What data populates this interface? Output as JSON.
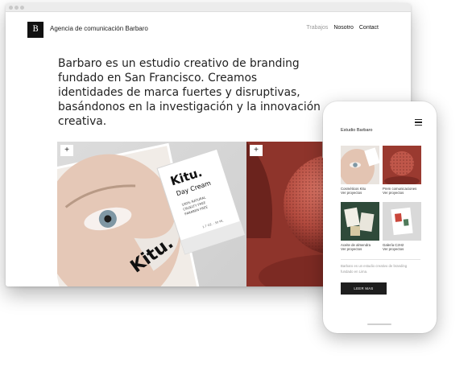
{
  "desktop": {
    "logo_letter": "B",
    "brand": "Agencia de comunicación Barbaro",
    "nav": [
      "Trabajos",
      "Nosotro",
      "Contact"
    ],
    "hero": "Barbaro es un estudio creativo de branding fundado en San Francisco. Creamos identidades de marca fuertes y disruptivas, basándonos en la investigación y la innovación creativa.",
    "plus": "+",
    "product": {
      "brand": "Kitu.",
      "name": "Day Cream",
      "details": [
        "100% NATURAL",
        "CRUELTY FREE",
        "PARABEN FREE"
      ],
      "size": "1.7 OZ. - 50 ML",
      "face_logo": "Kitu."
    }
  },
  "phone": {
    "title": "Estudio Barbaro",
    "items": [
      {
        "name": "Cosméticos Kitu",
        "link": "Ver proyectos"
      },
      {
        "name": "Prem comunicaciones",
        "link": "Ver proyectos"
      },
      {
        "name": "Aceite de almendra",
        "link": "Ver proyectos"
      },
      {
        "name": "Galería C2H2",
        "link": "Ver proyectos"
      }
    ],
    "blurb": "Barbaro es un estudio creativo de branding fundado en Lima.",
    "button": "LEER MAS"
  },
  "colors": {
    "nav_muted": "#9a9a9a",
    "image_red": "#a8433a",
    "thumb_green": "#2f4a3a",
    "button_dark": "#1e1e1e"
  },
  "icons": [
    "plus-icon",
    "hamburger-menu-icon"
  ]
}
